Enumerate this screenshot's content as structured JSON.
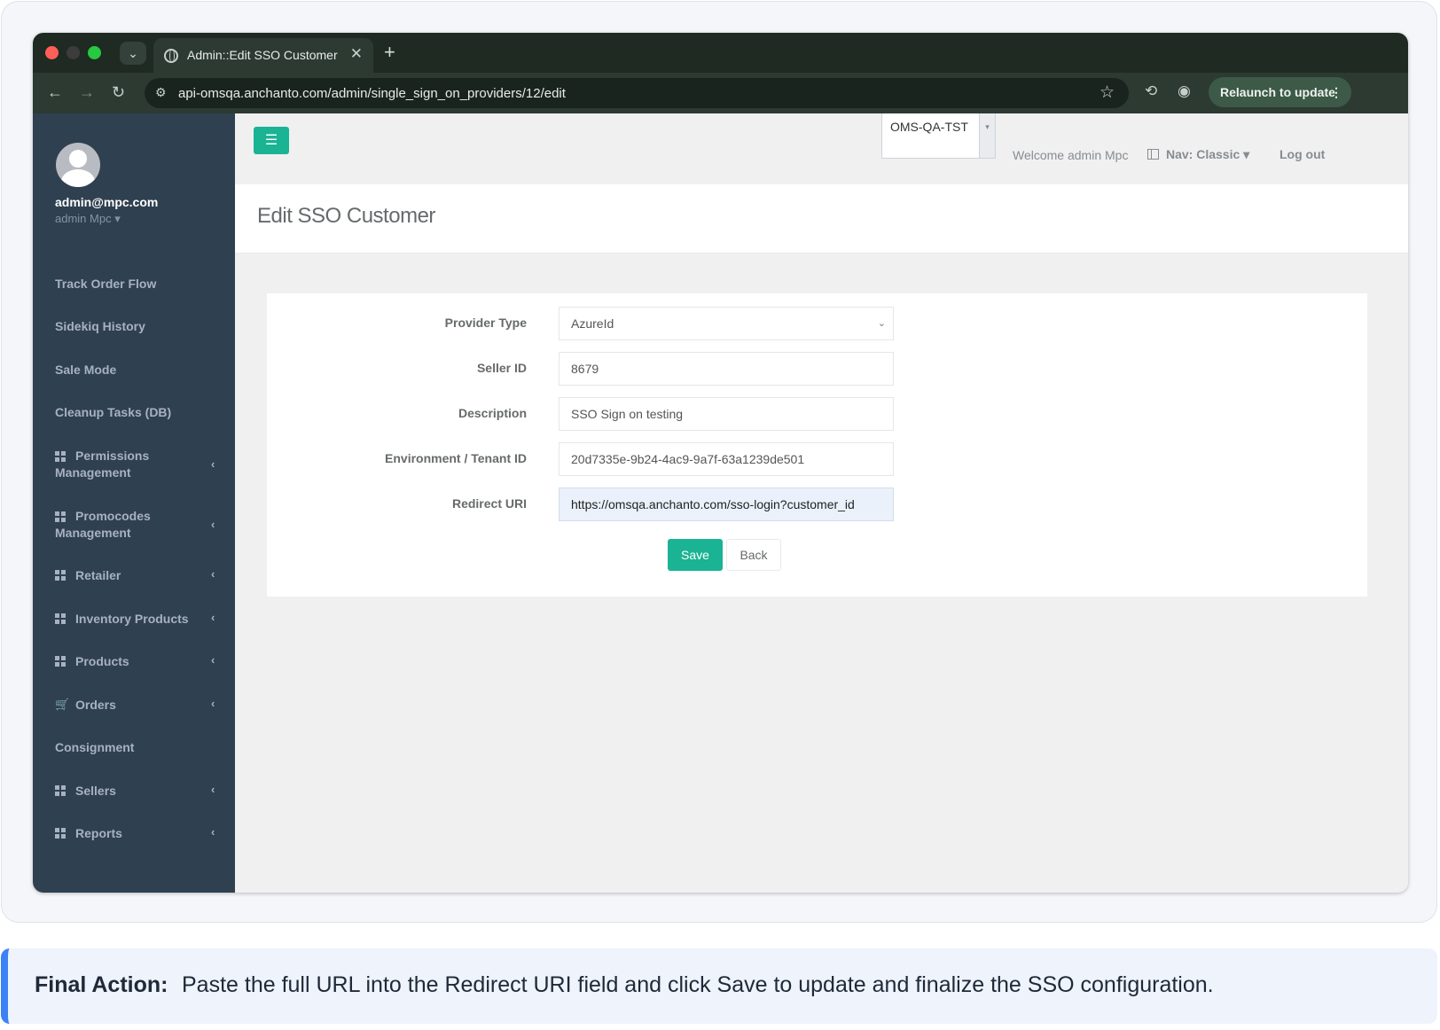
{
  "browser": {
    "tab_title": "Admin::Edit SSO Customer",
    "url": "api-omsqa.anchanto.com/admin/single_sign_on_providers/12/edit",
    "relaunch_label": "Relaunch to update"
  },
  "sidebar": {
    "user_email": "admin@mpc.com",
    "user_name": "admin Mpc",
    "items": [
      {
        "label": "Track Order Flow"
      },
      {
        "label": "Sidekiq History"
      },
      {
        "label": "Sale Mode"
      },
      {
        "label": "Cleanup Tasks (DB)"
      },
      {
        "label": "Permissions Management",
        "icon": "grid-icon"
      },
      {
        "label": "Promocodes Management",
        "icon": "grid-icon"
      },
      {
        "label": "Retailer",
        "icon": "grid-icon"
      },
      {
        "label": "Inventory Products",
        "icon": "grid-icon"
      },
      {
        "label": "Products",
        "icon": "grid-icon"
      },
      {
        "label": "Orders",
        "icon": "cart-icon"
      },
      {
        "label": "Consignment"
      },
      {
        "label": "Sellers",
        "icon": "grid-icon"
      },
      {
        "label": "Reports",
        "icon": "grid-icon"
      }
    ]
  },
  "topbar": {
    "environment": "OMS-QA-TST",
    "welcome": "Welcome admin Mpc",
    "nav_mode": "Nav: Classic",
    "logout": "Log out"
  },
  "page": {
    "title": "Edit SSO Customer"
  },
  "form": {
    "provider_type": {
      "label": "Provider Type",
      "value": "AzureId"
    },
    "seller_id": {
      "label": "Seller ID",
      "value": "8679"
    },
    "description": {
      "label": "Description",
      "value": "SSO Sign on testing"
    },
    "tenant_id": {
      "label": "Environment / Tenant ID",
      "value": "20d7335e-9b24-4ac9-9a7f-63a1239de501"
    },
    "redirect_uri": {
      "label": "Redirect URI",
      "value": "https://omsqa.anchanto.com/sso-login?customer_id"
    },
    "save_label": "Save",
    "back_label": "Back"
  },
  "caption": {
    "label": "Final Action:",
    "text": "Paste the full URL into the Redirect URI field and click Save to update and finalize the SSO configuration."
  },
  "colors": {
    "accent": "#1ab394",
    "sidebar": "#2f4050",
    "caption_border": "#3b82f6"
  }
}
